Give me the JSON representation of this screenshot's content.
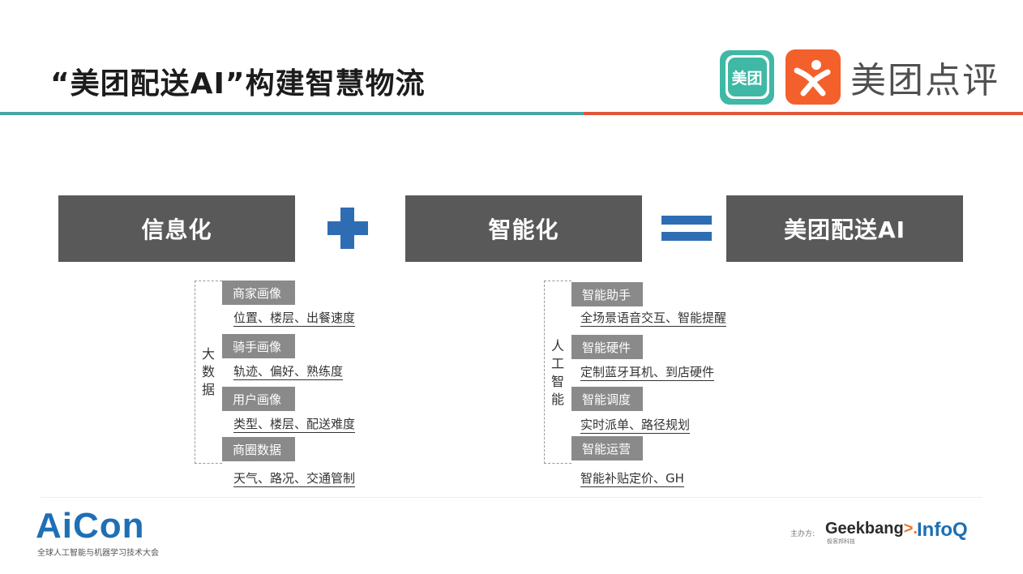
{
  "title": "“美团配送AI”构建智慧物流",
  "logos": {
    "meituan_badge": "美团",
    "brand_name": "美团点评"
  },
  "colors": {
    "teal_rule": "#49a7a3",
    "orange_rule": "#e1563b",
    "dark_box": "#595959",
    "blue_operator": "#2e6db3",
    "tag_gray": "#8a8a8a"
  },
  "equation": {
    "left": "信息化",
    "operator_1": "plus-icon",
    "middle": "智能化",
    "operator_2": "equals-icon",
    "result": "美团配送AI"
  },
  "big_data": {
    "label": "大数据",
    "items": [
      {
        "tag": "商家画像",
        "detail": "位置、楼层、出餐速度"
      },
      {
        "tag": "骑手画像",
        "detail": "轨迹、偏好、熟练度"
      },
      {
        "tag": "用户画像",
        "detail": "类型、楼层、配送难度"
      },
      {
        "tag": "商圈数据",
        "detail": "天气、路况、交通管制"
      }
    ]
  },
  "ai": {
    "label": "人工智能",
    "items": [
      {
        "tag": "智能助手",
        "detail": "全场景语音交互、智能提醒"
      },
      {
        "tag": "智能硬件",
        "detail": "定制蓝牙耳机、到店硬件"
      },
      {
        "tag": "智能调度",
        "detail": "实时派单、路径规划"
      },
      {
        "tag": "智能运营",
        "detail": "智能补贴定价、GH"
      }
    ]
  },
  "footer": {
    "aicon": "AiCon",
    "aicon_sub": "全球人工智能与机器学习技术大会",
    "sponsor_label": "主办方:",
    "geek_main": "Geekbang",
    "geek_arrow": ">.",
    "geek_sub": "极客邦科技",
    "infoq": "InfoQ"
  }
}
